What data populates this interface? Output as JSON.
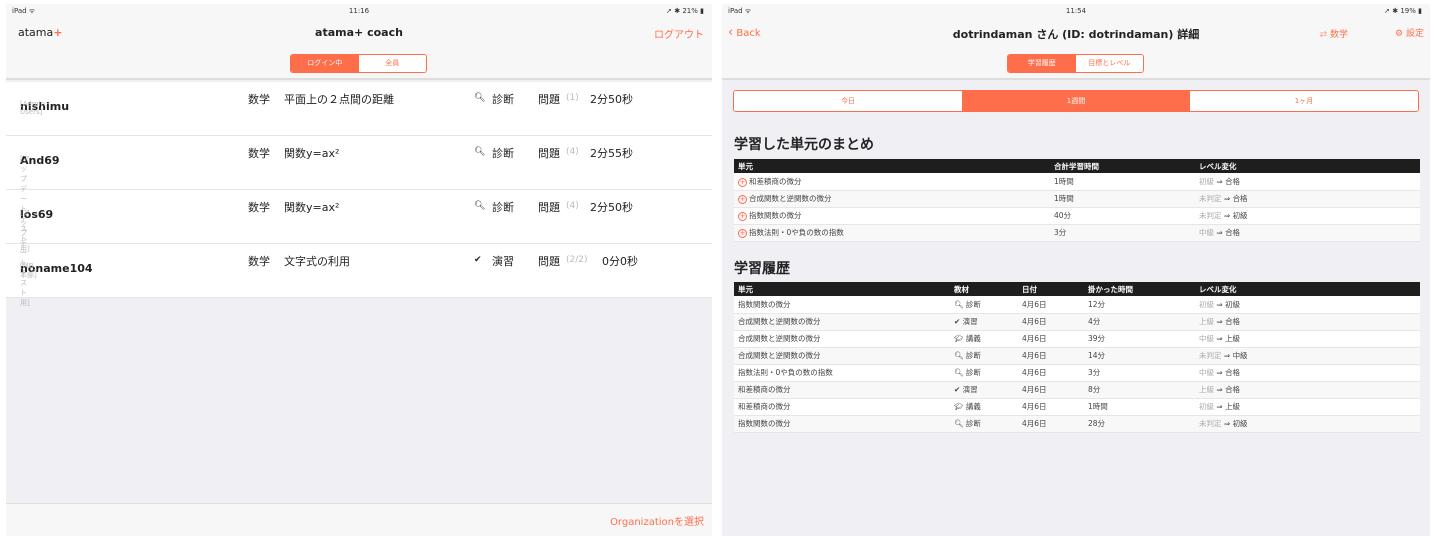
{
  "left": {
    "status": {
      "device": "iPad ᯤ",
      "time": "11:16",
      "battery": "➚ ✱ 21% ▮"
    },
    "logo": "atama",
    "logo_plus": "+",
    "title": "atama+ coach",
    "logout": "ログアウト",
    "tabs": [
      {
        "label": "ログイン中",
        "active": true
      },
      {
        "label": "全員",
        "active": false
      }
    ],
    "students": [
      {
        "name": "nishimu",
        "group": "[Admin Users]",
        "subject": "数学",
        "unit": "平面上の２点間の距離",
        "mode_icon": "search-icon",
        "mode": "診断",
        "q_label": "問題",
        "q_count": "(1)",
        "time": "2分50秒"
      },
      {
        "name": "And69",
        "group": "[アップデートテスト用]",
        "subject": "数学",
        "unit": "関数y=ax²",
        "mode_icon": "search-icon",
        "mode": "診断",
        "q_label": "問題",
        "q_count": "(4)",
        "time": "2分55秒"
      },
      {
        "name": "los69",
        "group": "[アップデートテスト用]",
        "subject": "数学",
        "unit": "関数y=ax²",
        "mode_icon": "search-icon",
        "mode": "診断",
        "q_label": "問題",
        "q_count": "(4)",
        "time": "2分50秒"
      },
      {
        "name": "noname104",
        "group": "[MB_本部]",
        "subject": "数学",
        "unit": "文字式の利用",
        "mode_icon": "check-icon",
        "mode": "演習",
        "q_label": "問題",
        "q_count": "(2/2)",
        "time": "0分0秒"
      }
    ],
    "org_select": "Organizationを選択"
  },
  "right": {
    "status": {
      "device": "iPad ᯤ",
      "time": "11:54",
      "battery": "➚ ✱ 19% ▮"
    },
    "back": "Back",
    "title": "dotrindaman さん (ID: dotrindaman) 詳細",
    "subject_switch": "数学",
    "settings": "設定",
    "tabs": [
      {
        "label": "学習履歴",
        "active": true
      },
      {
        "label": "目標とレベル",
        "active": false
      }
    ],
    "periods": [
      {
        "label": "今日",
        "active": false
      },
      {
        "label": "1週間",
        "active": true
      },
      {
        "label": "1ヶ月",
        "active": false
      }
    ],
    "summary": {
      "heading": "学習した単元のまとめ",
      "columns": [
        "単元",
        "合計学習時間",
        "レベル変化"
      ],
      "rows": [
        {
          "unit": "和差積商の微分",
          "time": "1時間",
          "from": "初級",
          "to": "合格"
        },
        {
          "unit": "合成関数と逆関数の微分",
          "time": "1時間",
          "from": "未判定",
          "to": "合格"
        },
        {
          "unit": "指数関数の微分",
          "time": "40分",
          "from": "未判定",
          "to": "初級"
        },
        {
          "unit": "指数法則・0や負の数の指数",
          "time": "3分",
          "from": "中級",
          "to": "合格"
        }
      ]
    },
    "history": {
      "heading": "学習履歴",
      "columns": [
        "単元",
        "教材",
        "日付",
        "掛かった時間",
        "レベル変化"
      ],
      "rows": [
        {
          "unit": "指数関数の微分",
          "icon": "search-icon",
          "material": "診断",
          "date": "4月6日",
          "time": "12分",
          "from": "初級",
          "to": "初級"
        },
        {
          "unit": "合成関数と逆関数の微分",
          "icon": "check-icon",
          "material": "演習",
          "date": "4月6日",
          "time": "4分",
          "from": "上級",
          "to": "合格"
        },
        {
          "unit": "合成関数と逆関数の微分",
          "icon": "graduation-cap-icon",
          "material": "講義",
          "date": "4月6日",
          "time": "39分",
          "from": "中級",
          "to": "上級"
        },
        {
          "unit": "合成関数と逆関数の微分",
          "icon": "search-icon",
          "material": "診断",
          "date": "4月6日",
          "time": "14分",
          "from": "未判定",
          "to": "中級"
        },
        {
          "unit": "指数法則・0や負の数の指数",
          "icon": "search-icon",
          "material": "診断",
          "date": "4月6日",
          "time": "3分",
          "from": "中級",
          "to": "合格"
        },
        {
          "unit": "和差積商の微分",
          "icon": "check-icon",
          "material": "演習",
          "date": "4月6日",
          "time": "8分",
          "from": "上級",
          "to": "合格"
        },
        {
          "unit": "和差積商の微分",
          "icon": "graduation-cap-icon",
          "material": "講義",
          "date": "4月6日",
          "time": "1時間",
          "from": "初級",
          "to": "上級"
        },
        {
          "unit": "指数関数の微分",
          "icon": "search-icon",
          "material": "診断",
          "date": "4月6日",
          "time": "28分",
          "from": "未判定",
          "to": "初級"
        }
      ]
    }
  }
}
